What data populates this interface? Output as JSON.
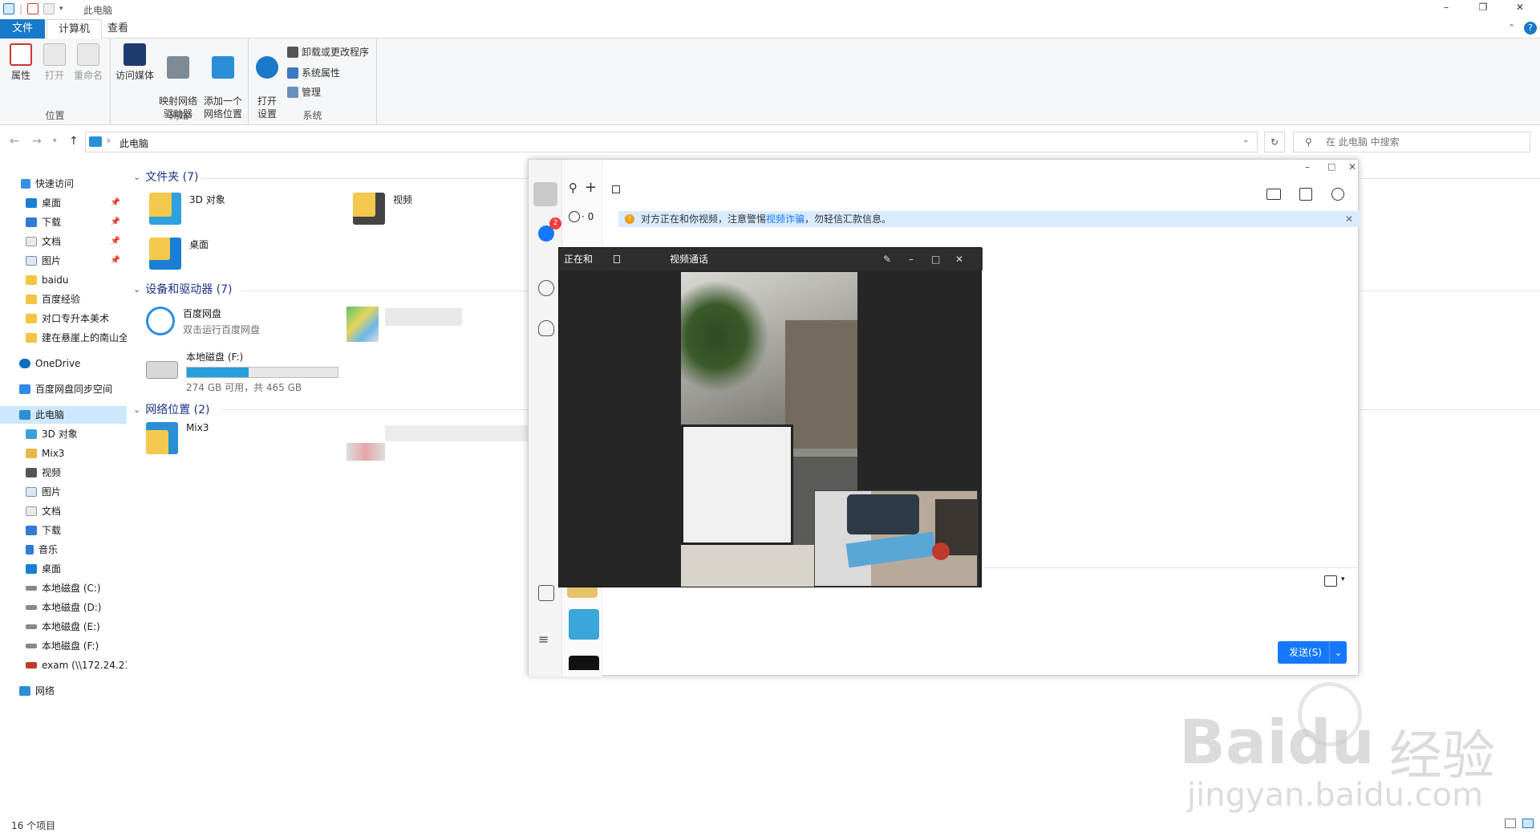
{
  "window": {
    "title": "此电脑",
    "controls": {
      "minimize": "–",
      "maximize": "❐",
      "close": "✕"
    }
  },
  "ribbon": {
    "tabs": [
      "文件",
      "计算机",
      "查看"
    ],
    "groups": {
      "location": {
        "label": "位置",
        "buttons": [
          "属性",
          "打开",
          "重命名"
        ]
      },
      "network": {
        "label": "网络",
        "buttons": [
          "访问媒体",
          "映射网络\n驱动器",
          "添加一个\n网络位置"
        ]
      },
      "system": {
        "label": "系统",
        "open_settings": "打开\n设置",
        "small": [
          "卸载或更改程序",
          "系统属性",
          "管理"
        ]
      }
    }
  },
  "address": {
    "path": "此电脑",
    "search_placeholder": "在 此电脑 中搜索"
  },
  "sidebar": {
    "quick_access": "快速访问",
    "quick_items": [
      "桌面",
      "下载",
      "文档",
      "图片",
      "baidu",
      "百度经验",
      "对口专升本美术",
      "建在悬崖上的南山全"
    ],
    "onedrive": "OneDrive",
    "baidu_sync": "百度网盘同步空间",
    "this_pc": "此电脑",
    "pc_items": [
      "3D 对象",
      "Mix3",
      "视频",
      "图片",
      "文档",
      "下载",
      "音乐",
      "桌面",
      "本地磁盘 (C:)",
      "本地磁盘 (D:)",
      "本地磁盘 (E:)",
      "本地磁盘 (F:)",
      "exam (\\\\172.24.21"
    ],
    "network": "网络"
  },
  "content": {
    "folders_header": "文件夹 (7)",
    "folders": [
      "3D 对象",
      "视频",
      "桌面"
    ],
    "devices_header": "设备和驱动器 (7)",
    "baidu_disk": {
      "name": "百度网盘",
      "sub": "双击运行百度网盘"
    },
    "local_disk": {
      "name": "本地磁盘 (F:)",
      "sub": "274 GB 可用，共 465 GB",
      "used_fraction": 0.41
    },
    "network_header": "网络位置 (2)",
    "network_items": [
      "Mix3"
    ]
  },
  "status": {
    "count": "16 个项目"
  },
  "qq": {
    "search_icon": "search-icon",
    "add_icon": "plus-icon",
    "status_count": "· 0",
    "badge": "2",
    "banner": {
      "text_a": "对方正在和你视频，注意警惕",
      "link": "视频诈骗",
      "text_b": "，勿轻信汇款信息。"
    },
    "send": "发送(S)"
  },
  "video_call": {
    "status": "正在和",
    "title": "视频通话"
  },
  "watermark": {
    "brand": "Baidu",
    "cn": "经验",
    "url": "jingyan.baidu.com"
  }
}
